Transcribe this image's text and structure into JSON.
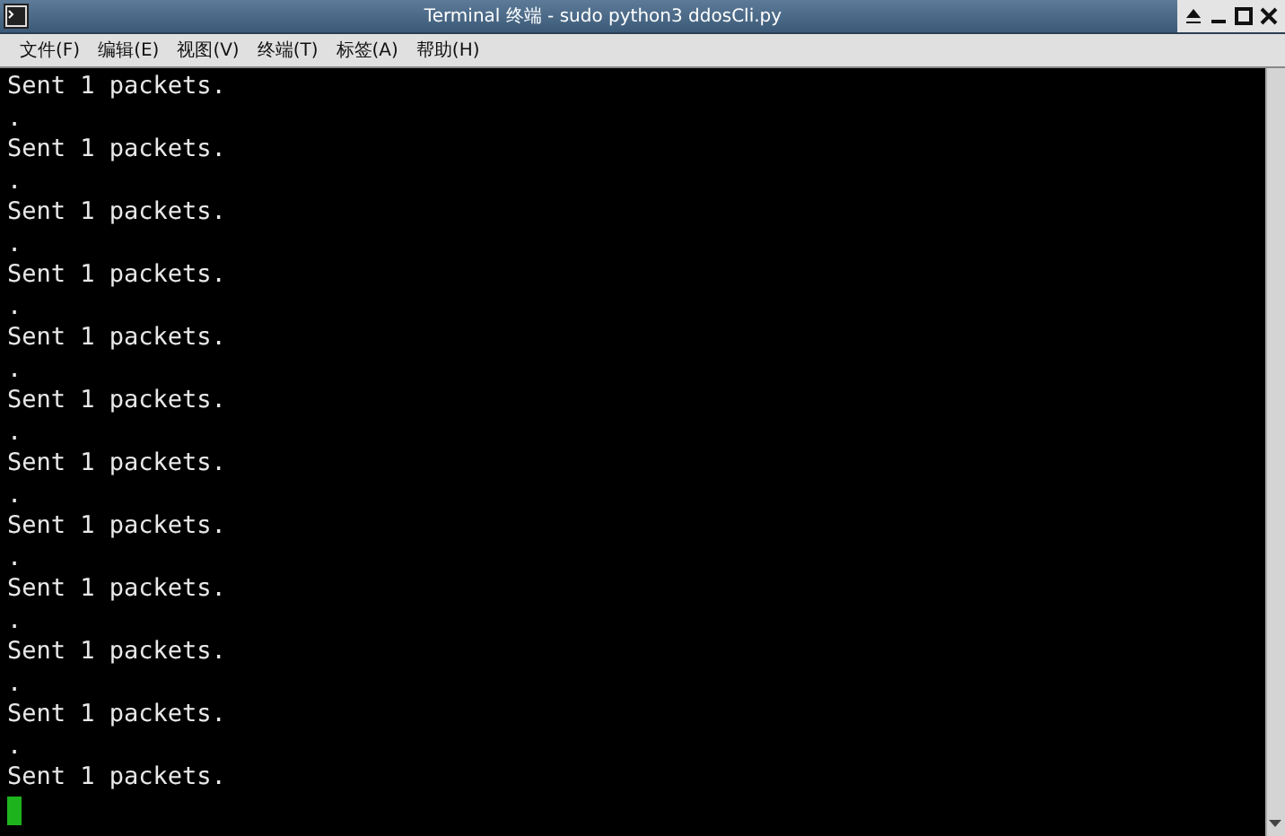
{
  "window": {
    "title": "Terminal 终端 - sudo python3 ddosCli.py"
  },
  "menu": [
    "文件(F)",
    "编辑(E)",
    "视图(V)",
    "终端(T)",
    "标签(A)",
    "帮助(H)"
  ],
  "terminal": {
    "lines": [
      "Sent 1 packets.",
      ".",
      "Sent 1 packets.",
      ".",
      "Sent 1 packets.",
      ".",
      "Sent 1 packets.",
      ".",
      "Sent 1 packets.",
      ".",
      "Sent 1 packets.",
      ".",
      "Sent 1 packets.",
      ".",
      "Sent 1 packets.",
      ".",
      "Sent 1 packets.",
      ".",
      "Sent 1 packets.",
      ".",
      "Sent 1 packets.",
      ".",
      "Sent 1 packets."
    ]
  }
}
